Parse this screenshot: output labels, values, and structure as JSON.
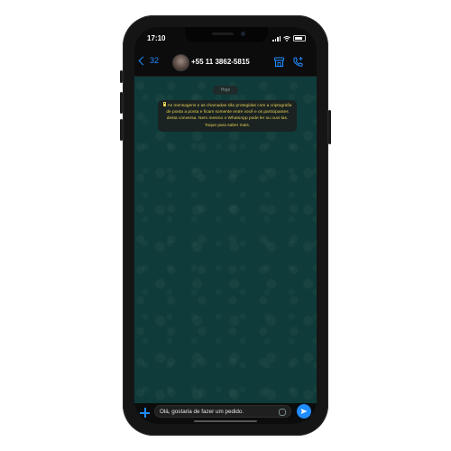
{
  "status_bar": {
    "time": "17:10",
    "icons": [
      "signal-icon",
      "wifi-icon",
      "battery-icon"
    ]
  },
  "header": {
    "back_count": "32",
    "contact_name": "+55 11 3862-5815",
    "icons": [
      "back-chevron-icon",
      "store-icon",
      "add-call-icon"
    ],
    "accent_color": "#1f8cff"
  },
  "chat": {
    "date_label": "Hoje",
    "encryption_notice": "As mensagens e as chamadas são protegidas com a criptografia de ponta a ponta e ficam somente entre você e os participantes desta conversa. Nem mesmo o WhatsApp pode ler ou ouvi-las. Toque para saber mais.",
    "notice_color": "#e6cf52",
    "background_color": "#0f3c3a"
  },
  "composer": {
    "message_value": "Olá, gostaria de fazer um pedido.",
    "icons": [
      "plus-icon",
      "sticker-icon",
      "send-icon"
    ],
    "send_color": "#1f8cff"
  }
}
